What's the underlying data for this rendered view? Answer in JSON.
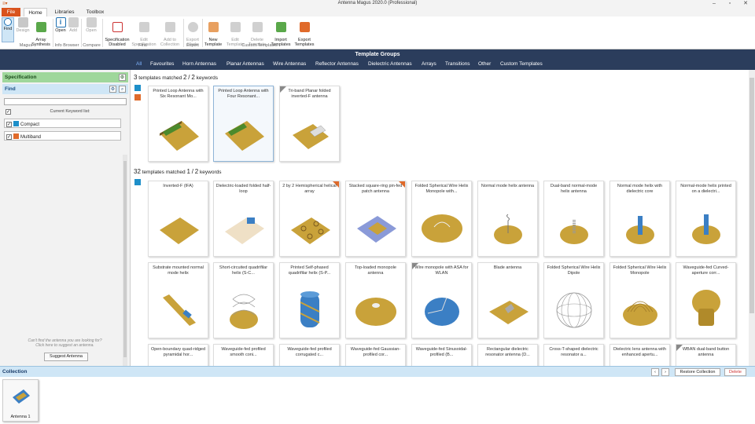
{
  "window": {
    "title": "Antenna Magus 2020.0 (Professional)",
    "quick_access": "≡▾"
  },
  "ribbon_tabs": [
    "File",
    "Home",
    "Libraries",
    "Toolbox"
  ],
  "ribbon": {
    "buttons": [
      {
        "label": "Find",
        "icon": "find-icon"
      },
      {
        "label": "Design",
        "icon": "design-icon"
      },
      {
        "label": "Array\nSynthesis",
        "icon": "array-synthesis-icon"
      },
      {
        "label": "Open",
        "icon": "info-icon"
      },
      {
        "label": "Add",
        "icon": "add-icon"
      },
      {
        "label": "Open",
        "icon": "compare-open-icon"
      },
      {
        "label": "Specification\nDisabled",
        "icon": "specification-icon"
      },
      {
        "label": "Edit\nSpecification",
        "icon": "edit-spec-icon"
      },
      {
        "label": "Add to\nCollection",
        "icon": "add-collection-icon"
      },
      {
        "label": "Export\nMode",
        "icon": "export-mode-icon"
      },
      {
        "label": "New\nTemplate",
        "icon": "new-template-icon"
      },
      {
        "label": "Edit\nTemplate",
        "icon": "edit-template-icon"
      },
      {
        "label": "Delete\nTemplate",
        "icon": "delete-template-icon"
      },
      {
        "label": "Import\nTemplates",
        "icon": "import-icon"
      },
      {
        "label": "Export\nTemplates",
        "icon": "export-icon"
      }
    ],
    "groups": [
      "Magus",
      "Info Browser",
      "Compare",
      "Find",
      "Export",
      "Custom Templates"
    ]
  },
  "template_groups": {
    "title": "Template Groups",
    "tabs": [
      "All",
      "Favourites",
      "Horn Antennas",
      "Planar Antennas",
      "Wire Antennas",
      "Reflector Antennas",
      "Dielectric Antennas",
      "Arrays",
      "Transitions",
      "Other",
      "Custom Templates"
    ]
  },
  "left_panel": {
    "specification_title": "Specification",
    "find_title": "Find",
    "keyword_list_label": "Current Keyword list:",
    "keywords": [
      {
        "label": "Compact",
        "color": "#1e8fc9"
      },
      {
        "label": "Multiband",
        "color": "#e06a2a"
      }
    ],
    "cant_find_text": "Can't find the antenna you are looking for?\nClick here to suggest an antenna.",
    "suggest_button": "Suggest Antenna"
  },
  "results": [
    {
      "count": "3",
      "label": "templates matched",
      "matched": "2",
      "sep": "/",
      "total": "2",
      "suffix": "keywords"
    },
    {
      "count": "32",
      "label": "templates matched",
      "matched": "1",
      "sep": "/",
      "total": "2",
      "suffix": "keywords"
    }
  ],
  "cards_top": [
    {
      "title": "Printed Loop Antenna with Six Resonant Mo..."
    },
    {
      "title": "Printed Loop Antenna with Four Resonant..."
    },
    {
      "title": "Tri-band Planar folded inverted-F antenna"
    }
  ],
  "cards_row1": [
    {
      "title": "Inverted-F (IFA)"
    },
    {
      "title": "Dielectric-loaded folded half-loop"
    },
    {
      "title": "2 by 2 Hemispherical helical array"
    },
    {
      "title": "Stacked square-ring pin-fed patch antenna"
    },
    {
      "title": "Folded Spherical Wire Helix Monopole with..."
    },
    {
      "title": "Normal mode helix antenna"
    },
    {
      "title": "Dual-band normal-mode helix antenna"
    },
    {
      "title": "Normal mode helix with dielectric core"
    },
    {
      "title": "Normal-mode helix printed on a dielectri..."
    }
  ],
  "cards_row2": [
    {
      "title": "Substrate mounted normal mode helix"
    },
    {
      "title": "Short-circuited quadrifilar helix (S-C..."
    },
    {
      "title": "Printed Self-phased quadrifilar helix (S-P..."
    },
    {
      "title": "Top-loaded monopole antenna"
    },
    {
      "title": "Wire monopole with ASA for WLAN"
    },
    {
      "title": "Blade antenna"
    },
    {
      "title": "Folded Spherical Wire Helix Dipole"
    },
    {
      "title": "Folded Spherical Wire Helix Monopole"
    },
    {
      "title": "Waveguide-fed Curved-aperture corr..."
    }
  ],
  "cards_row3": [
    {
      "title": "Open-boundary quad-ridged pyramidal hor..."
    },
    {
      "title": "Waveguide-fed profiled smooth coni..."
    },
    {
      "title": "Waveguide-fed profiled corrugated c..."
    },
    {
      "title": "Waveguide-fed Gaussian-profiled cor..."
    },
    {
      "title": "Waveguide-fed Sinusoidal-profiled (B..."
    },
    {
      "title": "Rectangular dielectric resonator antenna (D..."
    },
    {
      "title": "Cross-T-shaped dielectric resonator a..."
    },
    {
      "title": "Dielectric lens antenna with enhanced apertu..."
    },
    {
      "title": "WBAN dual-band button antenna"
    }
  ],
  "collection": {
    "title": "Collection",
    "restore_button": "Restore Collection",
    "delete_button": "Delete",
    "items": [
      {
        "title": "Antenna 1"
      }
    ]
  }
}
